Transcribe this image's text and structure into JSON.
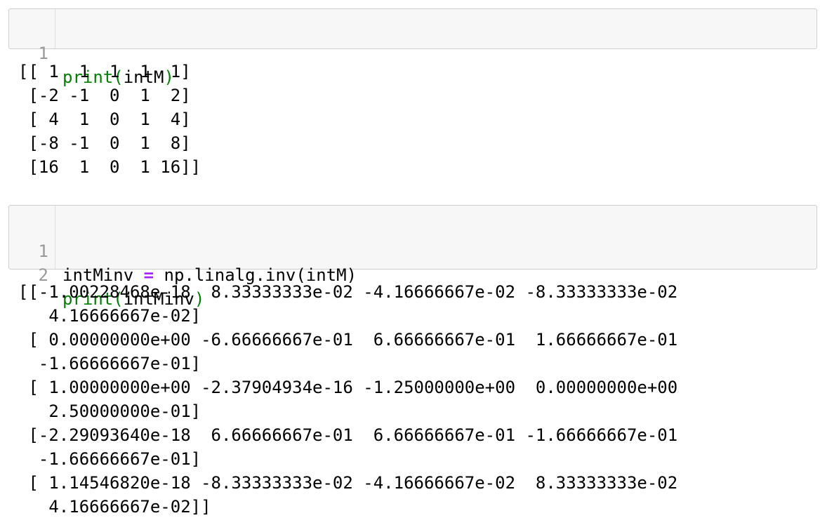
{
  "cells": [
    {
      "lines": [
        {
          "number": "1",
          "func": "print",
          "open": "(",
          "arg": "intM",
          "close": ")"
        }
      ],
      "output": "[[ 1  1  1  1  1]\n [-2 -1  0  1  2]\n [ 4  1  0  1  4]\n [-8 -1  0  1  8]\n [16  1  0  1 16]]"
    },
    {
      "lines": [
        {
          "number": "1",
          "lhs": "intMinv ",
          "op": "=",
          "rhs": " np.linalg.inv(intM)"
        },
        {
          "number": "2",
          "func": "print",
          "open": "(",
          "arg": "intMinv",
          "close": ")"
        }
      ],
      "output": "[[-1.00228468e-18  8.33333333e-02 -4.16666667e-02 -8.33333333e-02\n   4.16666667e-02]\n [ 0.00000000e+00 -6.66666667e-01  6.66666667e-01  1.66666667e-01\n  -1.66666667e-01]\n [ 1.00000000e+00 -2.37904934e-16 -1.25000000e+00  0.00000000e+00\n   2.50000000e-01]\n [-2.29093640e-18  6.66666667e-01  6.66666667e-01 -1.66666667e-01\n  -1.66666667e-01]\n [ 1.14546820e-18 -8.33333333e-02 -4.16666667e-02  8.33333333e-02\n   4.16666667e-02]]"
    }
  ],
  "colors": {
    "builtin": "#008000",
    "operator": "#aa22ff",
    "cell_background": "#f7f7f7",
    "cell_border": "#cfcfcf",
    "line_number": "#999999"
  }
}
